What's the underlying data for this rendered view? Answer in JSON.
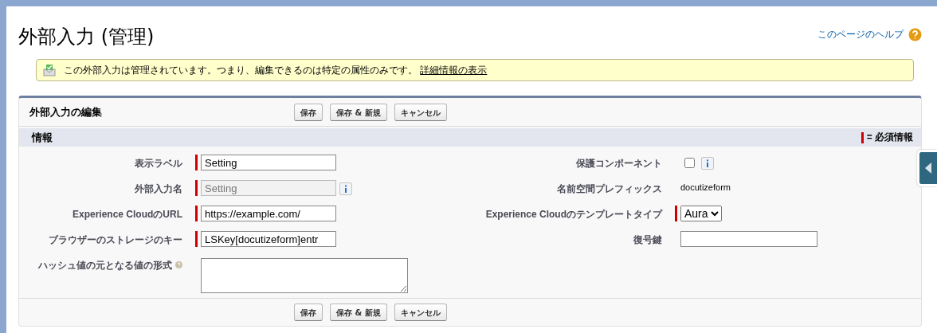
{
  "page": {
    "title": "外部入力 (管理)",
    "help_link": "このページのヘルプ"
  },
  "message": {
    "text": "この外部入力は管理されています。つまり、編集できるのは特定の属性のみです。",
    "link": "詳細情報の表示"
  },
  "panel": {
    "title": "外部入力の編集",
    "buttons": [
      "保存",
      "保存 & 新規",
      "キャンセル"
    ],
    "section": {
      "title": "情報",
      "required_legend": "= 必須情報"
    },
    "left_fields": [
      {
        "kind": "text",
        "label": "表示ラベル",
        "value": "Setting",
        "required": true,
        "disabled": false
      },
      {
        "kind": "text",
        "label": "外部入力名",
        "value": "Setting",
        "required": true,
        "disabled": true,
        "info": true
      },
      {
        "kind": "text",
        "label": "Experience CloudのURL",
        "value": "https://example.com/",
        "required": true,
        "disabled": false
      },
      {
        "kind": "text",
        "label": "ブラウザーのストレージのキー",
        "value": "LSKey[docutizeform]entr",
        "required": true,
        "disabled": false
      },
      {
        "kind": "textarea",
        "label": "ハッシュ値の元となる値の形式",
        "required": false,
        "help": true
      }
    ],
    "right_fields": [
      {
        "kind": "checkbox",
        "label": "保護コンポーネント",
        "checked": false,
        "info": true
      },
      {
        "kind": "static",
        "label": "名前空間プレフィックス",
        "value": "docutizeform"
      },
      {
        "kind": "select",
        "label": "Experience Cloudのテンプレートタイプ",
        "value": "Aura",
        "required": true
      },
      {
        "kind": "text",
        "label": "復号鍵",
        "required": false,
        "disabled": false
      }
    ],
    "footer_buttons": [
      "保存",
      "保存 & 新規",
      "キャンセル"
    ]
  }
}
